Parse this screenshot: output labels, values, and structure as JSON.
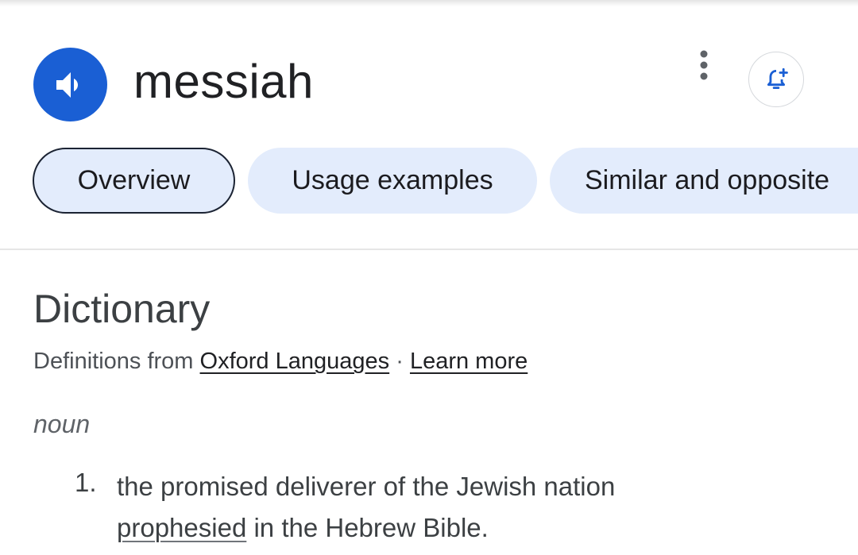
{
  "header": {
    "word": "messiah",
    "speaker_icon": "volume-icon",
    "more_icon": "more-vert-icon",
    "alert_icon": "add-alert-icon"
  },
  "tabs": [
    {
      "label": "Overview",
      "selected": true
    },
    {
      "label": "Usage examples",
      "selected": false
    },
    {
      "label": "Similar and opposite",
      "selected": false
    }
  ],
  "dictionary": {
    "title": "Dictionary",
    "source_prefix": "Definitions from",
    "source_link": "Oxford Languages",
    "separator": "·",
    "learn_more": "Learn more"
  },
  "entry": {
    "part_of_speech": "noun",
    "definitions": [
      {
        "number": "1.",
        "text_part1": "the promised deliverer of the Jewish nation",
        "link_word": "prophesied",
        "text_part2": "in the Hebrew Bible."
      }
    ]
  },
  "colors": {
    "accent_blue": "#1a5fd4",
    "tab_background": "#e3ecfc",
    "selected_tab_border": "#1b2333"
  }
}
